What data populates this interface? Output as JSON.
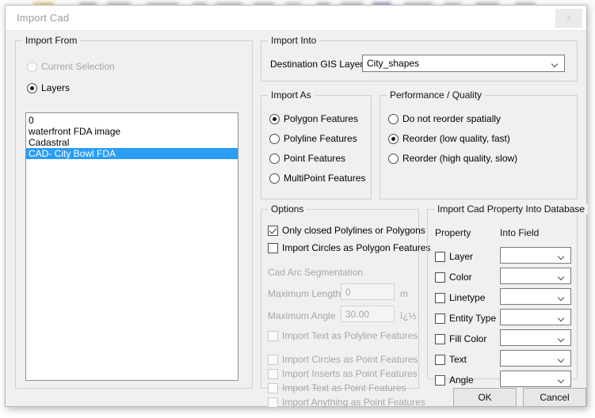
{
  "window": {
    "title": "Import Cad",
    "close_label": "x"
  },
  "import_from": {
    "legend": "Import From",
    "options": [
      {
        "label": "Current Selection",
        "checked": false,
        "disabled": true
      },
      {
        "label": "Layers",
        "checked": true,
        "disabled": false
      }
    ],
    "layers": [
      {
        "name": "0",
        "selected": false
      },
      {
        "name": "waterfront FDA image",
        "selected": false
      },
      {
        "name": "Cadastral",
        "selected": false
      },
      {
        "name": "CAD- City Bowl FDA",
        "selected": true
      }
    ]
  },
  "import_into": {
    "legend": "Import Into",
    "destination_label": "Destination GIS Layer",
    "destination_value": "City_shapes",
    "dropdown_icon": "chevron-down-icon"
  },
  "import_as": {
    "legend": "Import As",
    "options": [
      {
        "label": "Polygon Features",
        "checked": true
      },
      {
        "label": "Polyline Features",
        "checked": false
      },
      {
        "label": "Point Features",
        "checked": false
      },
      {
        "label": "MultiPoint Features",
        "checked": false
      }
    ]
  },
  "performance": {
    "legend": "Performance / Quality",
    "options": [
      {
        "label": "Do not reorder spatially",
        "checked": false
      },
      {
        "label": "Reorder (low quality, fast)",
        "checked": true
      },
      {
        "label": "Reorder (high quality, slow)",
        "checked": false
      }
    ]
  },
  "options": {
    "legend": "Options",
    "top_checks": [
      {
        "label": "Only closed Polylines or Polygons",
        "checked": true,
        "disabled": false
      },
      {
        "label": "Import Circles as Polygon Features",
        "checked": false,
        "disabled": false
      }
    ],
    "arc_segmentation": {
      "legend": "Cad Arc Segmentation",
      "max_length_label": "Maximum Length",
      "max_length_value": "0",
      "max_length_unit": "m",
      "max_angle_label": "Maximum Angle",
      "max_angle_value": "30.00",
      "max_angle_unit": "ï¿½"
    },
    "bottom_checks": [
      {
        "label": "Import Text as Polyline Features",
        "checked": false,
        "disabled": true
      },
      {
        "label": "Import Circles as Point Features",
        "checked": false,
        "disabled": true
      },
      {
        "label": "Import Inserts as Point Features",
        "checked": false,
        "disabled": true
      },
      {
        "label": "Import Text as Point Features",
        "checked": false,
        "disabled": true
      },
      {
        "label": "Import Anything as Point Features",
        "checked": false,
        "disabled": true
      }
    ]
  },
  "property_mapping": {
    "legend": "Import Cad Property Into Database",
    "col_property": "Property",
    "col_field": "Into Field",
    "rows": [
      {
        "property": "Layer",
        "checked": false,
        "field_value": ""
      },
      {
        "property": "Color",
        "checked": false,
        "field_value": ""
      },
      {
        "property": "Linetype",
        "checked": false,
        "field_value": ""
      },
      {
        "property": "Entity Type",
        "checked": false,
        "field_value": ""
      },
      {
        "property": "Fill Color",
        "checked": false,
        "field_value": ""
      },
      {
        "property": "Text",
        "checked": false,
        "field_value": ""
      },
      {
        "property": "Angle",
        "checked": false,
        "field_value": ""
      }
    ]
  },
  "footer": {
    "ok_label": "OK",
    "cancel_label": "Cancel"
  },
  "colors": {
    "selection_blue": "#2a9df4",
    "dialog_bg": "#f0f0f0",
    "titlebar_bg": "#ffffff"
  }
}
